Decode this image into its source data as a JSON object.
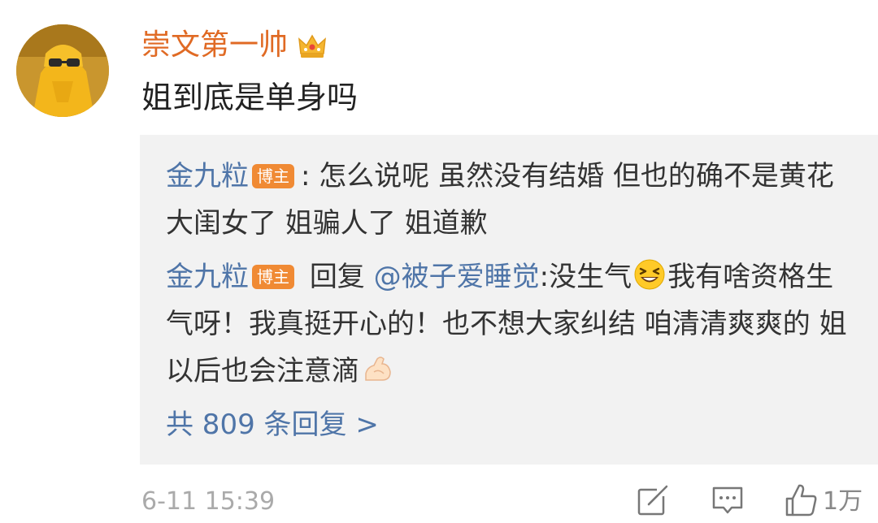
{
  "comment": {
    "username": "崇文第一帅",
    "text": "姐到底是单身吗",
    "user_badge_icon": "crown-icon",
    "username_color": "#e06a24"
  },
  "replies": [
    {
      "author": "金九粒",
      "badge": "博主",
      "separator": ":",
      "text": "怎么说呢 虽然没有结婚 但也的确不是黄花大闺女了 姐骗人了 姐道歉"
    },
    {
      "author": "金九粒",
      "badge": "博主",
      "reply_prefix": "回复",
      "mention": "@被子爱睡觉",
      "text_before_emoji": ":没生气",
      "emoji_1": "laughing-squint-emoji",
      "text_after_emoji": "我有啥资格生气呀！我真挺开心的！也不想大家纠结 咱清清爽爽的 姐以后也会注意滴",
      "emoji_2": "flexed-biceps-emoji"
    }
  ],
  "more_replies": "共 809 条回复 >",
  "footer": {
    "timestamp": "6-11 15:39",
    "like_count": "1万",
    "icons": [
      "share-icon",
      "comment-icon",
      "like-icon"
    ]
  },
  "colors": {
    "link_blue": "#4f75a8",
    "badge_orange": "#f08a34",
    "reply_bg": "#f2f2f2",
    "meta_gray": "#aaaaaa"
  }
}
